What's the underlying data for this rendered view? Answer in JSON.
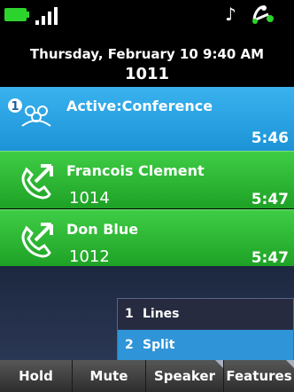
{
  "status": {
    "battery": "battery-icon",
    "signal": "signal-icon",
    "ringer": "music-note-icon",
    "headset": "headset-icon"
  },
  "header": {
    "datetime": "Thursday, February 10 9:40 AM",
    "extension": "1011"
  },
  "calls": [
    {
      "badge": "1",
      "title": "Active:Conference",
      "time": "5:46",
      "color": "#2aa4e4",
      "icon": "conference-icon"
    },
    {
      "title": "Francois Clement",
      "number": "1014",
      "time": "5:47",
      "color": "#2fb836",
      "icon": "phone-call-icon"
    },
    {
      "title": "Don Blue",
      "number": "1012",
      "time": "5:47",
      "color": "#2fb836",
      "icon": "phone-call-icon"
    }
  ],
  "menu": [
    {
      "num": "1",
      "label": "Lines"
    },
    {
      "num": "2",
      "label": "Split"
    }
  ],
  "softkeys": {
    "hold": "Hold",
    "mute": "Mute",
    "speaker": "Speaker",
    "features": "Features"
  }
}
